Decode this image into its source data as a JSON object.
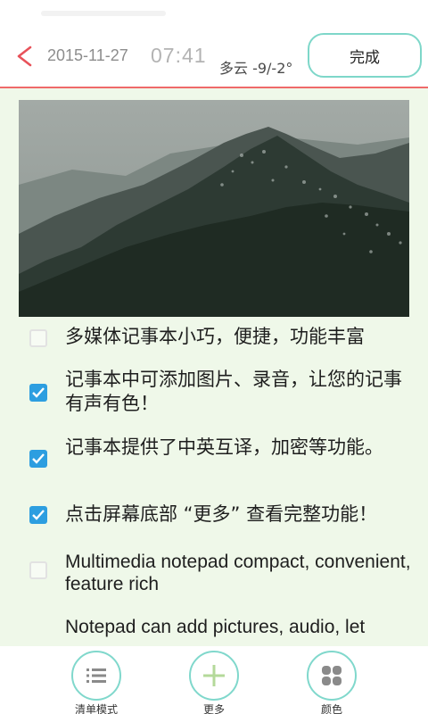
{
  "header": {
    "date": "2015-11-27",
    "time": "07:41",
    "weather": "多云 -9/-2°",
    "done_label": "完成",
    "back_icon": "chevron-left-icon"
  },
  "checklist": [
    {
      "text": "多媒体记事本小巧，便捷，功能丰富",
      "checked": false
    },
    {
      "text": "记事本中可添加图片、录音，让您的记事有声有色！",
      "checked": true
    },
    {
      "text": "记事本提供了中英互译，加密等功能。",
      "checked": true
    },
    {
      "text": "点击屏幕底部 “更多” 查看完整功能！",
      "checked": true
    },
    {
      "text": "Multimedia notepad compact, convenient, feature rich",
      "checked": false
    },
    {
      "text": "Notepad can add pictures, audio, let",
      "checked": false
    }
  ],
  "bottom_bar": {
    "list_mode_label": "清单模式",
    "more_label": "更多",
    "color_label": "颜色"
  },
  "colors": {
    "accent": "#2d9ee0",
    "header_line": "#ef6a6a",
    "button_border": "#80d8cc",
    "background": "#eff8e9"
  }
}
